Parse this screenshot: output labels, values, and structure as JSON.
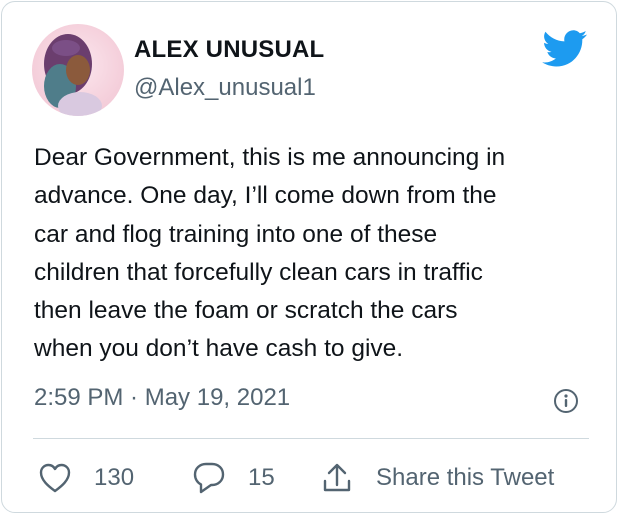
{
  "tweet": {
    "author_name": "ALEX UNUSUAL",
    "author_handle": "@Alex_unusual1",
    "text_lines": [
      "Dear Government, this is me announcing in",
      "advance. One day, I’ll come down from the",
      "car and flog training into one of these",
      "children that forcefully clean cars in traffic",
      "then leave the foam or scratch the cars",
      "when you don’t have cash to give."
    ],
    "timestamp": "2:59 PM · May 19, 2021",
    "likes": "130",
    "replies": "15",
    "share_label": "Share this Tweet"
  },
  "colors": {
    "brand": "#1d9bf0",
    "text": "#0f1419",
    "secondary": "#536471",
    "border": "#cfd9de"
  },
  "icons": [
    "twitter-bird-icon",
    "info-icon",
    "heart-icon",
    "reply-bubble-icon",
    "share-icon"
  ]
}
